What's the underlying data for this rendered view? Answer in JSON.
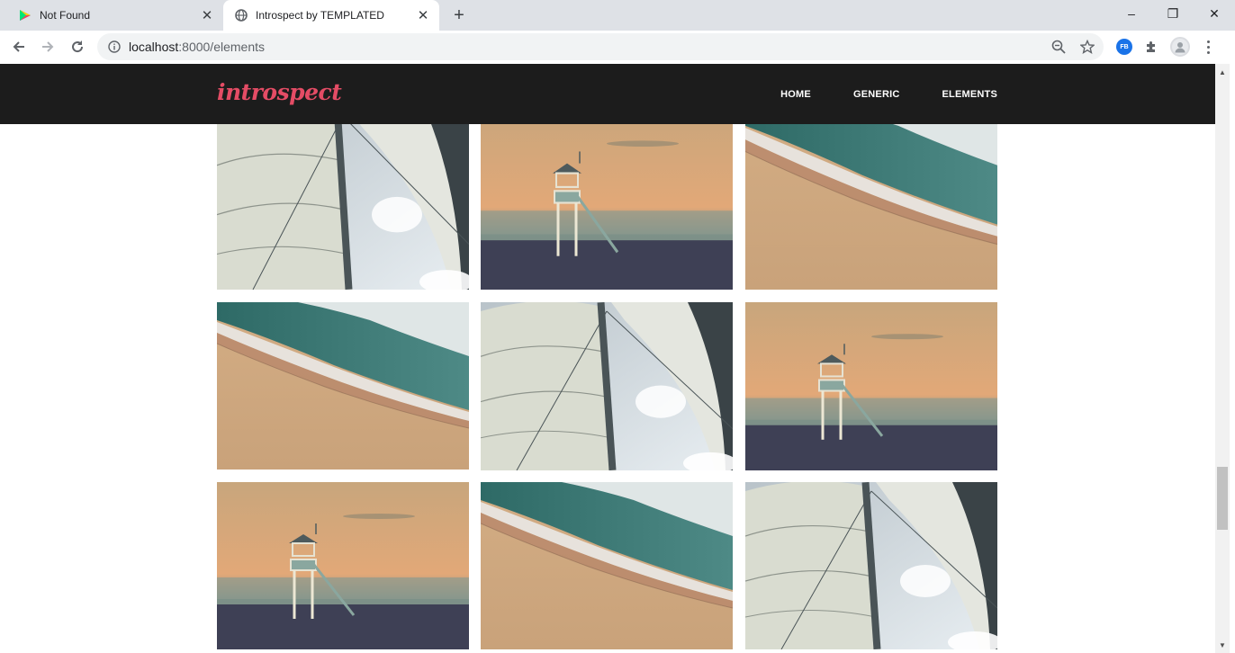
{
  "browser": {
    "tabs": [
      {
        "title": "Not Found",
        "icon": "play-store-icon",
        "active": false
      },
      {
        "title": "Introspect by TEMPLATED",
        "icon": "globe-icon",
        "active": true
      }
    ],
    "address": {
      "host": "localhost",
      "path": ":8000/elements"
    },
    "extension_label": "FB",
    "window_controls": {
      "minimize": "–",
      "maximize": "❐",
      "close": "✕"
    },
    "colors": {
      "tabstrip": "#dee1e6",
      "omnibox": "#f1f3f4"
    }
  },
  "site": {
    "logo": "introspect",
    "nav": [
      "Home",
      "Generic",
      "Elements"
    ],
    "colors": {
      "header_bg": "#1c1c1c",
      "logo": "#e44c65",
      "nav_text": "#ffffff"
    }
  },
  "gallery": {
    "images": [
      "sailboat-sail-image",
      "lifeguard-tower-image",
      "beach-waves-image",
      "beach-waves-image",
      "sailboat-sail-image",
      "lifeguard-tower-image",
      "lifeguard-tower-image",
      "beach-waves-image",
      "sailboat-sail-image"
    ]
  }
}
